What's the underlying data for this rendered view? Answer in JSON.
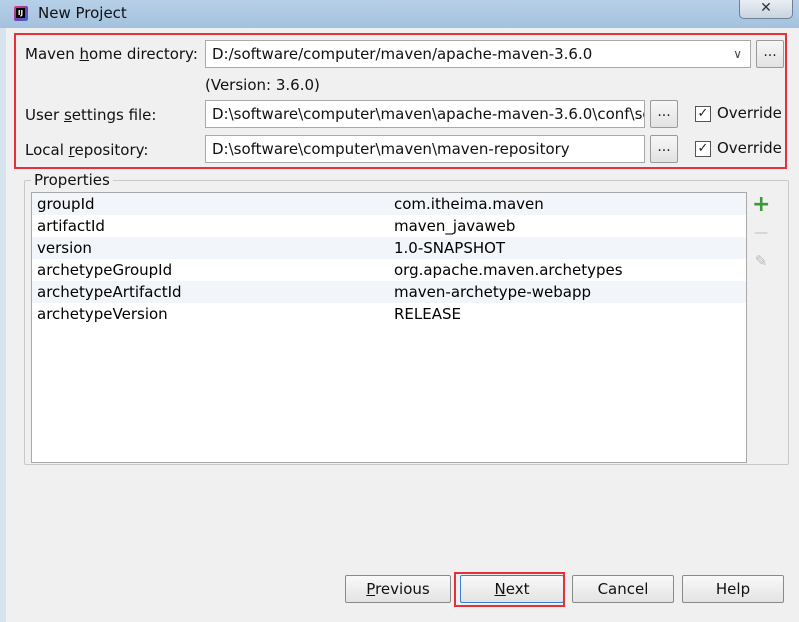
{
  "window": {
    "title": "New Project"
  },
  "icons": {
    "app": "intellij-icon",
    "close": "close-icon"
  },
  "form": {
    "maven_home": {
      "label_pre": "Maven ",
      "label_ul": "h",
      "label_post": "ome directory:",
      "value": "D:/software/computer/maven/apache-maven-3.6.0"
    },
    "version_note": "(Version: 3.6.0)",
    "user_settings": {
      "label_pre": "User ",
      "label_ul": "s",
      "label_post": "ettings file:",
      "value": "D:\\software\\computer\\maven\\apache-maven-3.6.0\\conf\\se",
      "override_label": "Override",
      "override_checked": true
    },
    "local_repo": {
      "label_pre": "Local ",
      "label_ul": "r",
      "label_post": "epository:",
      "value": "D:\\software\\computer\\maven\\maven-repository",
      "override_label": "Override",
      "override_checked": true
    },
    "browse_label": "..."
  },
  "properties": {
    "title": "Properties",
    "rows": [
      {
        "key": "groupId",
        "value": "com.itheima.maven"
      },
      {
        "key": "artifactId",
        "value": "maven_javaweb"
      },
      {
        "key": "version",
        "value": "1.0-SNAPSHOT"
      },
      {
        "key": "archetypeGroupId",
        "value": "org.apache.maven.archetypes"
      },
      {
        "key": "archetypeArtifactId",
        "value": "maven-archetype-webapp"
      },
      {
        "key": "archetypeVersion",
        "value": "RELEASE"
      }
    ],
    "add_symbol": "+",
    "remove_symbol": "—",
    "edit_symbol": "✎"
  },
  "buttons": {
    "previous": {
      "ul": "P",
      "rest": "revious"
    },
    "next": {
      "ul": "N",
      "rest": "ext"
    },
    "cancel": "Cancel",
    "help": "Help"
  },
  "colors": {
    "highlight": "#e8303a",
    "add": "#3a9a3a"
  }
}
